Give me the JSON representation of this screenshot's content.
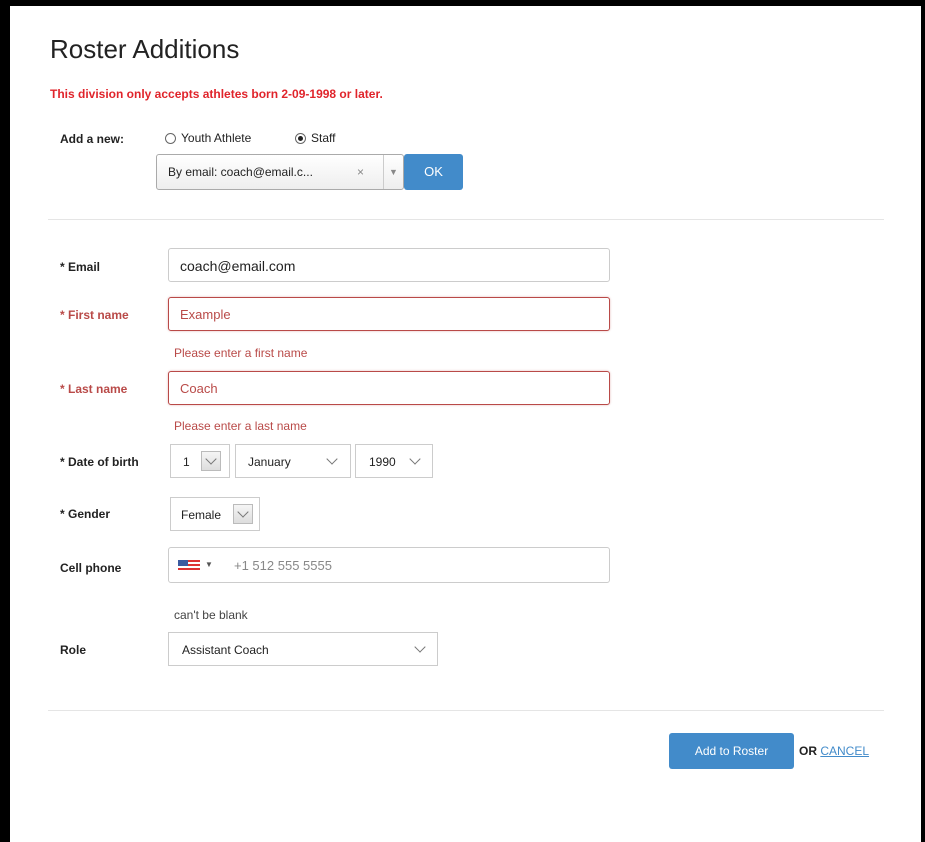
{
  "page": {
    "title": "Roster Additions",
    "warning": "This division only accepts athletes born 2-09-1998 or later."
  },
  "add_new": {
    "label": "Add a new:",
    "options": [
      {
        "label": "Youth Athlete",
        "selected": false
      },
      {
        "label": "Staff",
        "selected": true
      }
    ],
    "combo_value": "By email: coach@email.c...",
    "clear_glyph": "×",
    "ok_label": "OK"
  },
  "form": {
    "email": {
      "label": "* Email",
      "value": "coach@email.com"
    },
    "first_name": {
      "label": "* First name",
      "value": "Example",
      "error": "Please enter a first name"
    },
    "last_name": {
      "label": "* Last name",
      "value": "Coach",
      "error": "Please enter a last name"
    },
    "dob": {
      "label": "* Date of birth",
      "day": "1",
      "month": "January",
      "year": "1990"
    },
    "gender": {
      "label": "* Gender",
      "value": "Female"
    },
    "cell_phone": {
      "label": "Cell phone",
      "value": "+1 512 555 5555",
      "helper": "can't be blank"
    },
    "role": {
      "label": "Role",
      "value": "Assistant Coach"
    }
  },
  "actions": {
    "submit_label": "Add to Roster",
    "or_label": "OR",
    "cancel_label": "CANCEL"
  },
  "colors": {
    "accent": "#428bca",
    "warning": "#e0242b",
    "error": "#b94a48"
  }
}
